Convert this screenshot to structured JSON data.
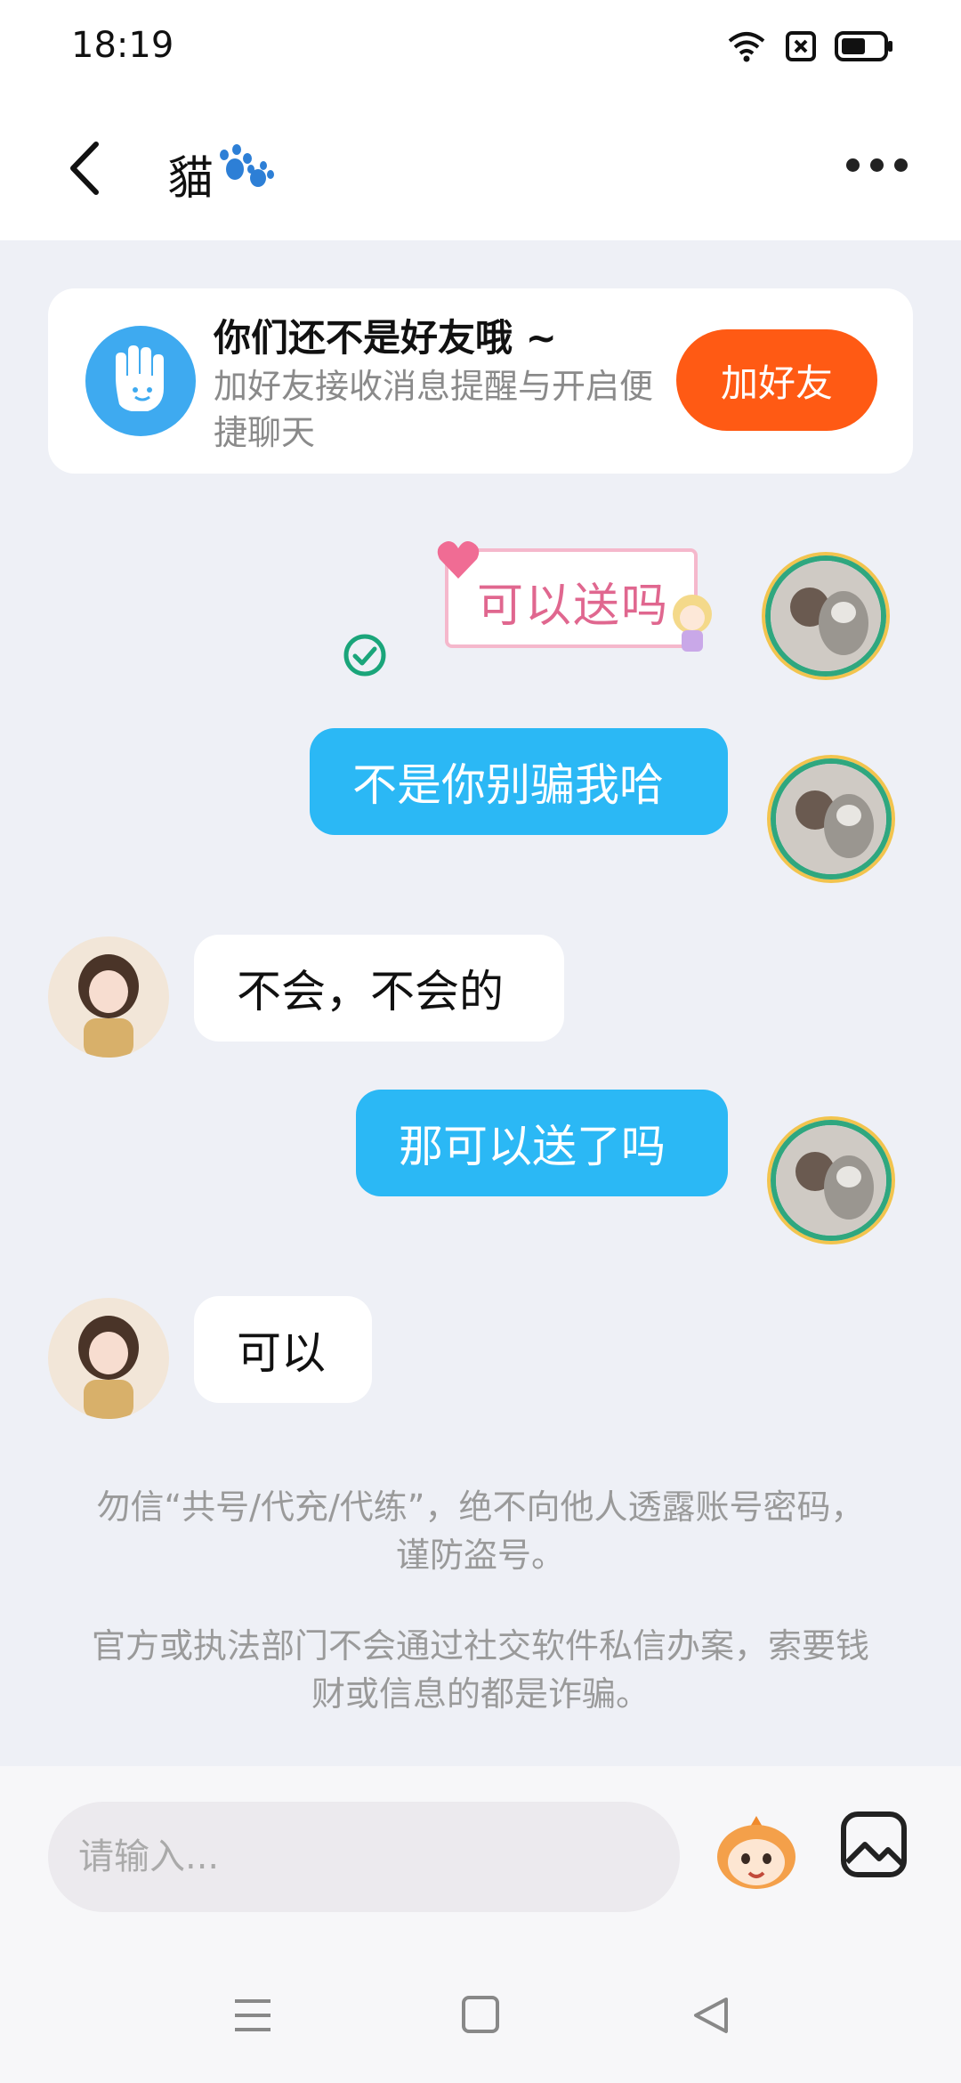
{
  "status": {
    "time": "18:19"
  },
  "header": {
    "title": "貓"
  },
  "friend_card": {
    "title": "你们还不是好友哦 ~",
    "subtitle": "加好友接收消息提醒与开启便捷聊天",
    "button_label": "加好友"
  },
  "messages": [
    {
      "sender": "self",
      "type": "sticker",
      "text": "可以送吗"
    },
    {
      "sender": "self",
      "type": "text",
      "text": "不是你别骗我哈"
    },
    {
      "sender": "other",
      "type": "text",
      "text": "不会，不会的"
    },
    {
      "sender": "self",
      "type": "text",
      "text": "那可以送了吗"
    },
    {
      "sender": "other",
      "type": "text",
      "text": "可以"
    }
  ],
  "notices": [
    "勿信“共号/代充/代练”，绝不向他人透露账号密码，谨防盗号。",
    "官方或执法部门不会通过社交软件私信办案，索要钱财或信息的都是诈骗。"
  ],
  "input": {
    "placeholder": "请输入..."
  },
  "colors": {
    "outgoing_bubble": "#2bb8f5",
    "add_friend_button": "#ff5a14",
    "accent_blue": "#3eaaf0"
  }
}
